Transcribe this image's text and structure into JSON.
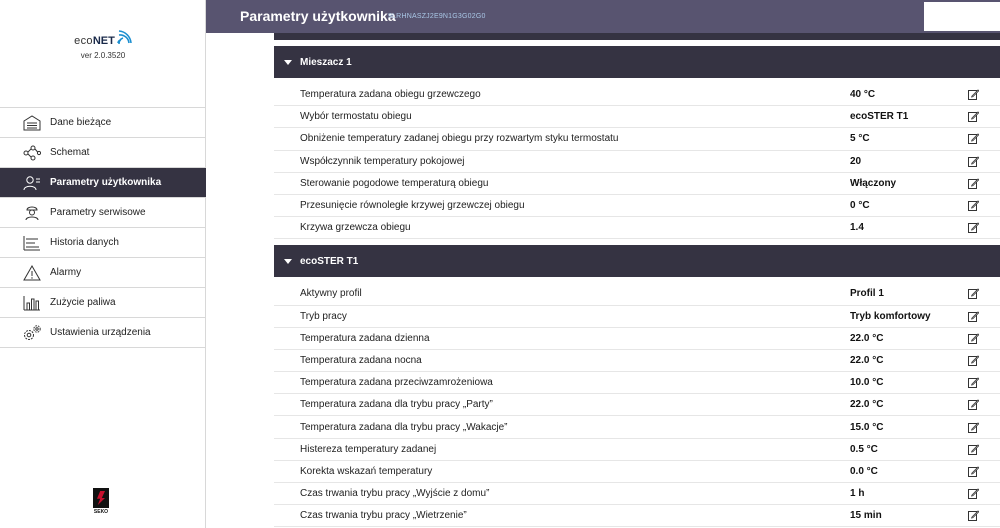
{
  "app": {
    "logo_eco": "eco",
    "logo_net": "NET",
    "version": "ver 2.0.3520",
    "brand_text": "SEKO"
  },
  "header": {
    "title": "Parametry użytkownika",
    "serial": "9LRHNASZJ2E9N1G3G02G0"
  },
  "sidebar": {
    "items": [
      {
        "label": "Dane bieżące",
        "icon": "current-data-icon"
      },
      {
        "label": "Schemat",
        "icon": "schema-icon"
      },
      {
        "label": "Parametry użytkownika",
        "icon": "user-params-icon",
        "active": true
      },
      {
        "label": "Parametry serwisowe",
        "icon": "service-params-icon"
      },
      {
        "label": "Historia danych",
        "icon": "history-icon"
      },
      {
        "label": "Alarmy",
        "icon": "alarm-icon"
      },
      {
        "label": "Zużycie paliwa",
        "icon": "fuel-icon"
      },
      {
        "label": "Ustawienia urządzenia",
        "icon": "settings-icon"
      }
    ]
  },
  "sections": [
    {
      "title": "Mieszacz 1",
      "rows": [
        {
          "label": "Temperatura zadana obiegu grzewczego",
          "value": "40 °C"
        },
        {
          "label": "Wybór termostatu obiegu",
          "value": "ecoSTER T1"
        },
        {
          "label": "Obniżenie temperatury zadanej obiegu przy rozwartym styku termostatu",
          "value": "5 °C"
        },
        {
          "label": "Współczynnik temperatury pokojowej",
          "value": "20"
        },
        {
          "label": "Sterowanie pogodowe temperaturą obiegu",
          "value": "Włączony"
        },
        {
          "label": "Przesunięcie równoległe krzywej grzewczej obiegu",
          "value": "0 °C"
        },
        {
          "label": "Krzywa grzewcza obiegu",
          "value": "1.4"
        }
      ]
    },
    {
      "title": "ecoSTER T1",
      "rows": [
        {
          "label": "Aktywny profil",
          "value": "Profil 1"
        },
        {
          "label": "Tryb pracy",
          "value": "Tryb komfortowy"
        },
        {
          "label": "Temperatura zadana dzienna",
          "value": "22.0 °C"
        },
        {
          "label": "Temperatura zadana nocna",
          "value": "22.0 °C"
        },
        {
          "label": "Temperatura zadana przeciwzamrożeniowa",
          "value": "10.0 °C"
        },
        {
          "label": "Temperatura zadana dla trybu pracy „Party”",
          "value": "22.0 °C"
        },
        {
          "label": "Temperatura zadana dla trybu pracy „Wakacje”",
          "value": "15.0 °C"
        },
        {
          "label": "Histereza temperatury zadanej",
          "value": "0.5 °C"
        },
        {
          "label": "Korekta wskazań temperatury",
          "value": "0.0 °C"
        },
        {
          "label": "Czas trwania trybu pracy „Wyjście z domu”",
          "value": "1 h"
        },
        {
          "label": "Czas trwania trybu pracy „Wietrzenie”",
          "value": "15 min"
        }
      ]
    }
  ],
  "colors": {
    "header_bg": "#585470",
    "section_bg": "#353342",
    "active_menu_bg": "#353342",
    "serial_text": "#a9c7e6"
  }
}
